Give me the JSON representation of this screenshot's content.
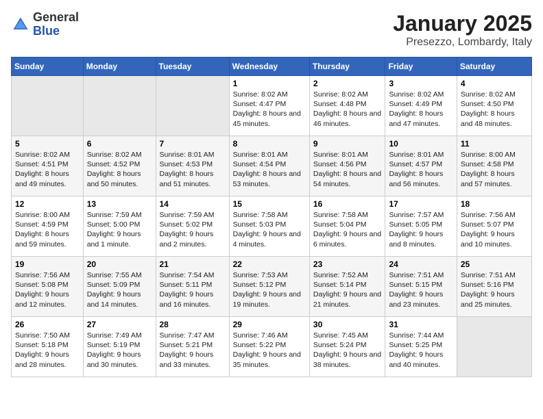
{
  "header": {
    "logo_general": "General",
    "logo_blue": "Blue",
    "title": "January 2025",
    "subtitle": "Presezzo, Lombardy, Italy"
  },
  "days_of_week": [
    "Sunday",
    "Monday",
    "Tuesday",
    "Wednesday",
    "Thursday",
    "Friday",
    "Saturday"
  ],
  "weeks": [
    [
      {
        "empty": true
      },
      {
        "empty": true
      },
      {
        "empty": true
      },
      {
        "day": 1,
        "sunrise": "8:02 AM",
        "sunset": "4:47 PM",
        "daylight": "8 hours and 45 minutes."
      },
      {
        "day": 2,
        "sunrise": "8:02 AM",
        "sunset": "4:48 PM",
        "daylight": "8 hours and 46 minutes."
      },
      {
        "day": 3,
        "sunrise": "8:02 AM",
        "sunset": "4:49 PM",
        "daylight": "8 hours and 47 minutes."
      },
      {
        "day": 4,
        "sunrise": "8:02 AM",
        "sunset": "4:50 PM",
        "daylight": "8 hours and 48 minutes."
      }
    ],
    [
      {
        "day": 5,
        "sunrise": "8:02 AM",
        "sunset": "4:51 PM",
        "daylight": "8 hours and 49 minutes."
      },
      {
        "day": 6,
        "sunrise": "8:02 AM",
        "sunset": "4:52 PM",
        "daylight": "8 hours and 50 minutes."
      },
      {
        "day": 7,
        "sunrise": "8:01 AM",
        "sunset": "4:53 PM",
        "daylight": "8 hours and 51 minutes."
      },
      {
        "day": 8,
        "sunrise": "8:01 AM",
        "sunset": "4:54 PM",
        "daylight": "8 hours and 53 minutes."
      },
      {
        "day": 9,
        "sunrise": "8:01 AM",
        "sunset": "4:56 PM",
        "daylight": "8 hours and 54 minutes."
      },
      {
        "day": 10,
        "sunrise": "8:01 AM",
        "sunset": "4:57 PM",
        "daylight": "8 hours and 56 minutes."
      },
      {
        "day": 11,
        "sunrise": "8:00 AM",
        "sunset": "4:58 PM",
        "daylight": "8 hours and 57 minutes."
      }
    ],
    [
      {
        "day": 12,
        "sunrise": "8:00 AM",
        "sunset": "4:59 PM",
        "daylight": "8 hours and 59 minutes."
      },
      {
        "day": 13,
        "sunrise": "7:59 AM",
        "sunset": "5:00 PM",
        "daylight": "9 hours and 1 minute."
      },
      {
        "day": 14,
        "sunrise": "7:59 AM",
        "sunset": "5:02 PM",
        "daylight": "9 hours and 2 minutes."
      },
      {
        "day": 15,
        "sunrise": "7:58 AM",
        "sunset": "5:03 PM",
        "daylight": "9 hours and 4 minutes."
      },
      {
        "day": 16,
        "sunrise": "7:58 AM",
        "sunset": "5:04 PM",
        "daylight": "9 hours and 6 minutes."
      },
      {
        "day": 17,
        "sunrise": "7:57 AM",
        "sunset": "5:05 PM",
        "daylight": "9 hours and 8 minutes."
      },
      {
        "day": 18,
        "sunrise": "7:56 AM",
        "sunset": "5:07 PM",
        "daylight": "9 hours and 10 minutes."
      }
    ],
    [
      {
        "day": 19,
        "sunrise": "7:56 AM",
        "sunset": "5:08 PM",
        "daylight": "9 hours and 12 minutes."
      },
      {
        "day": 20,
        "sunrise": "7:55 AM",
        "sunset": "5:09 PM",
        "daylight": "9 hours and 14 minutes."
      },
      {
        "day": 21,
        "sunrise": "7:54 AM",
        "sunset": "5:11 PM",
        "daylight": "9 hours and 16 minutes."
      },
      {
        "day": 22,
        "sunrise": "7:53 AM",
        "sunset": "5:12 PM",
        "daylight": "9 hours and 19 minutes."
      },
      {
        "day": 23,
        "sunrise": "7:52 AM",
        "sunset": "5:14 PM",
        "daylight": "9 hours and 21 minutes."
      },
      {
        "day": 24,
        "sunrise": "7:51 AM",
        "sunset": "5:15 PM",
        "daylight": "9 hours and 23 minutes."
      },
      {
        "day": 25,
        "sunrise": "7:51 AM",
        "sunset": "5:16 PM",
        "daylight": "9 hours and 25 minutes."
      }
    ],
    [
      {
        "day": 26,
        "sunrise": "7:50 AM",
        "sunset": "5:18 PM",
        "daylight": "9 hours and 28 minutes."
      },
      {
        "day": 27,
        "sunrise": "7:49 AM",
        "sunset": "5:19 PM",
        "daylight": "9 hours and 30 minutes."
      },
      {
        "day": 28,
        "sunrise": "7:47 AM",
        "sunset": "5:21 PM",
        "daylight": "9 hours and 33 minutes."
      },
      {
        "day": 29,
        "sunrise": "7:46 AM",
        "sunset": "5:22 PM",
        "daylight": "9 hours and 35 minutes."
      },
      {
        "day": 30,
        "sunrise": "7:45 AM",
        "sunset": "5:24 PM",
        "daylight": "9 hours and 38 minutes."
      },
      {
        "day": 31,
        "sunrise": "7:44 AM",
        "sunset": "5:25 PM",
        "daylight": "9 hours and 40 minutes."
      },
      {
        "empty": true
      }
    ]
  ]
}
